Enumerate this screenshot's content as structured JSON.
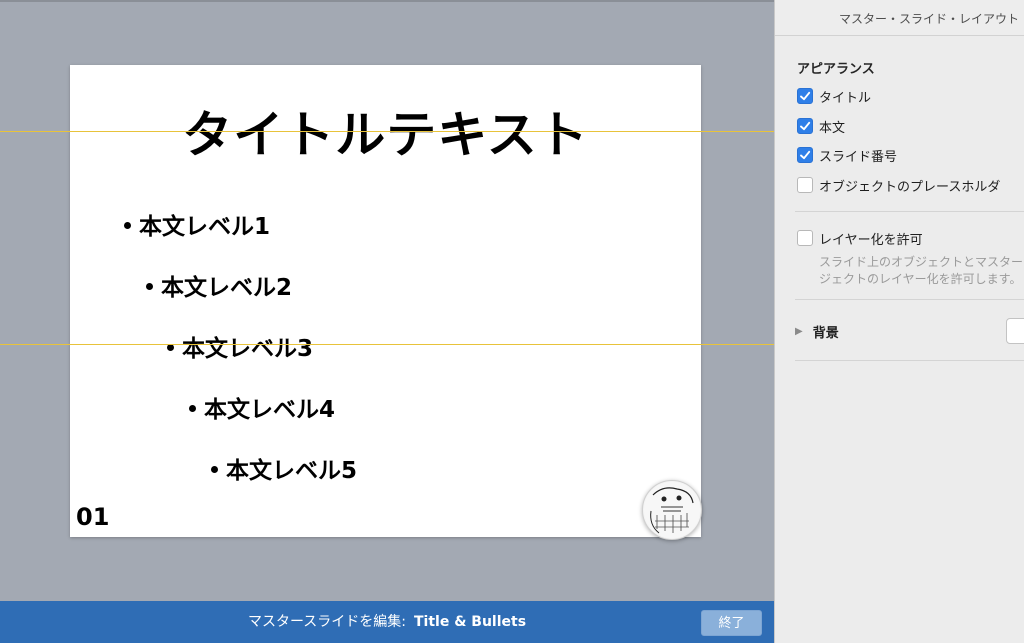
{
  "slide": {
    "title": "タイトルテキスト",
    "bullets": [
      {
        "text": "本文レベル1"
      },
      {
        "text": "本文レベル2"
      },
      {
        "text": "本文レベル3"
      },
      {
        "text": "本文レベル4"
      },
      {
        "text": "本文レベル5"
      }
    ],
    "slide_number": "01"
  },
  "bottom_bar": {
    "label": "マスタースライドを編集:",
    "layout_name": "Title & Bullets",
    "done_label": "終了"
  },
  "inspector": {
    "title": "マスター・スライド・レイアウト",
    "appearance": {
      "section_title": "アピアランス",
      "options": [
        {
          "label": "タイトル",
          "checked": true
        },
        {
          "label": "本文",
          "checked": true
        },
        {
          "label": "スライド番号",
          "checked": true
        },
        {
          "label": "オブジェクトのプレースホルダ",
          "checked": false
        }
      ]
    },
    "layering": {
      "label": "レイヤー化を許可",
      "checked": false,
      "description_line1": "スライド上のオブジェクトとマスター",
      "description_line2": "ジェクトのレイヤー化を許可します。"
    },
    "background": {
      "label": "背景"
    }
  },
  "colors": {
    "accent": "#2f6db5",
    "checkbox_checked": "#2f7fe8",
    "guide_line": "#e8c33a",
    "canvas_bg": "#a3a9b3"
  }
}
